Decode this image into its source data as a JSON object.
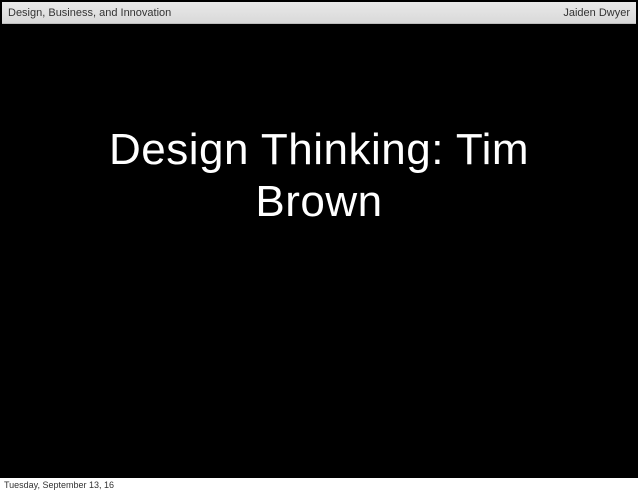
{
  "header": {
    "course_title": "Design, Business, and Innovation",
    "author": "Jaiden Dwyer"
  },
  "slide": {
    "title": "Design Thinking: Tim Brown"
  },
  "footer": {
    "date": "Tuesday, September 13, 16"
  },
  "colors": {
    "slide_background": "#000000",
    "title_text": "#ffffff",
    "header_background": "#e0e0e0"
  }
}
